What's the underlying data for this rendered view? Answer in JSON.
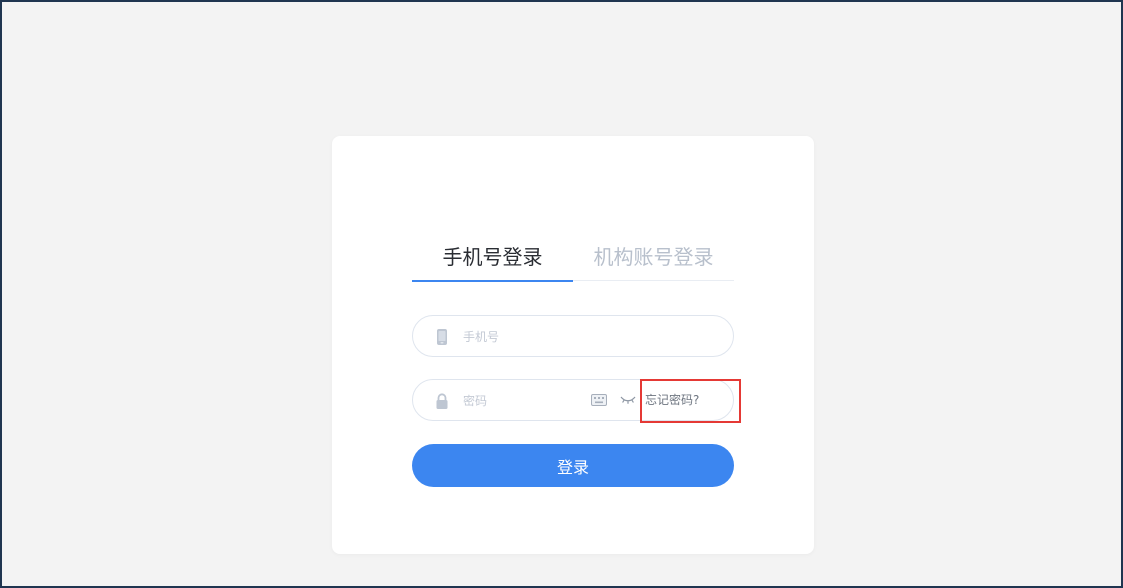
{
  "login": {
    "tabs": [
      {
        "label": "手机号登录",
        "active": true
      },
      {
        "label": "机构账号登录",
        "active": false
      }
    ],
    "phone_placeholder": "手机号",
    "password_placeholder": "密码",
    "forgot_password_label": "忘记密码?",
    "submit_label": "登录"
  },
  "icons": {
    "phone": "phone-icon",
    "lock": "lock-icon",
    "keyboard": "keyboard-icon",
    "eye": "eye-closed-icon"
  },
  "colors": {
    "page_background": "#f3f3f3",
    "card_background": "#ffffff",
    "primary": "#3c86f0",
    "highlight": "#e53935",
    "inactive_text": "#b8c0cc"
  }
}
